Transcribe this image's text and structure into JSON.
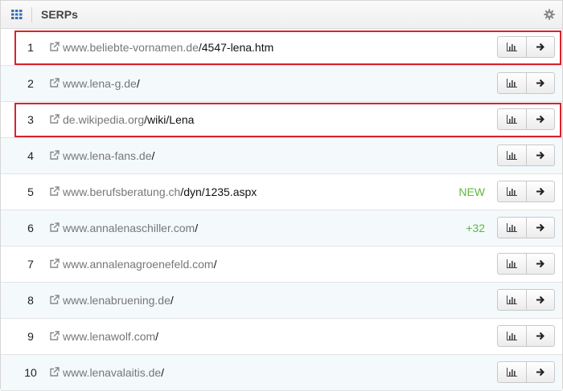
{
  "header": {
    "title": "SERPs"
  },
  "rows": [
    {
      "rank": "1",
      "domain": "www.beliebte-vornamen.de",
      "path": "/4547-lena.htm",
      "badge": "",
      "highlight": true
    },
    {
      "rank": "2",
      "domain": "www.lena-g.de",
      "path": "/",
      "badge": "",
      "highlight": false
    },
    {
      "rank": "3",
      "domain": "de.wikipedia.org",
      "path": "/wiki/Lena",
      "badge": "",
      "highlight": true
    },
    {
      "rank": "4",
      "domain": "www.lena-fans.de",
      "path": "/",
      "badge": "",
      "highlight": false
    },
    {
      "rank": "5",
      "domain": "www.berufsberatung.ch",
      "path": "/dyn/1235.aspx",
      "badge": "NEW",
      "highlight": false
    },
    {
      "rank": "6",
      "domain": "www.annalenaschiller.com",
      "path": "/",
      "badge": "+32",
      "highlight": false
    },
    {
      "rank": "7",
      "domain": "www.annalenagroenefeld.com",
      "path": "/",
      "badge": "",
      "highlight": false
    },
    {
      "rank": "8",
      "domain": "www.lenabruening.de",
      "path": "/",
      "badge": "",
      "highlight": false
    },
    {
      "rank": "9",
      "domain": "www.lenawolf.com",
      "path": "/",
      "badge": "",
      "highlight": false
    },
    {
      "rank": "10",
      "domain": "www.lenavalaitis.de",
      "path": "/",
      "badge": "",
      "highlight": false
    }
  ],
  "icons": {
    "header_left": "grid-icon",
    "header_right": "gear-icon",
    "link": "external-link-icon",
    "chart_button": "bar-chart-icon",
    "go_button": "arrow-right-icon"
  },
  "colors": {
    "highlight_border": "#d9222a",
    "badge_green": "#5cb83c",
    "grid_icon_blue": "#3a6fb5"
  }
}
